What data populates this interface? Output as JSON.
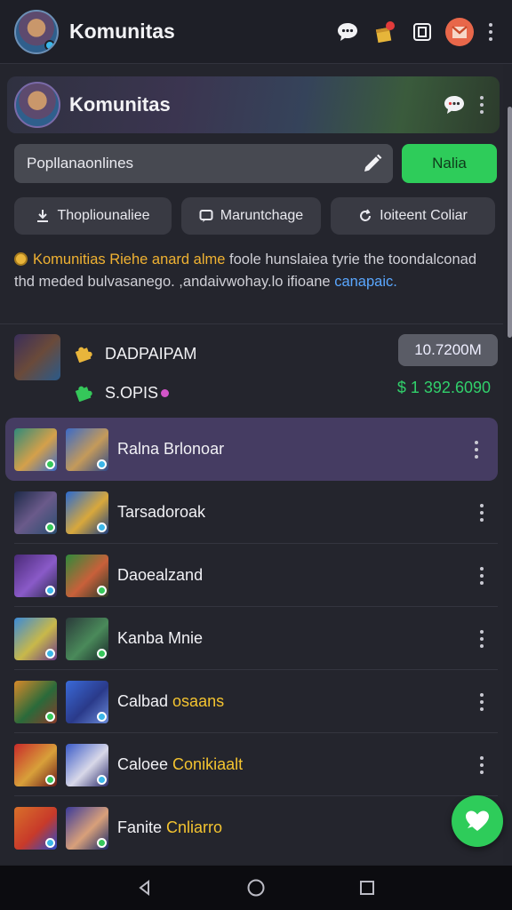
{
  "header": {
    "title": "Komunitas"
  },
  "banner": {
    "title": "Komunitas"
  },
  "search": {
    "value": "Popllanaonlines",
    "button_label": "Nalia"
  },
  "chips": [
    {
      "label": "Thopliounaliee",
      "icon": "download-icon"
    },
    {
      "label": "Maruntchage",
      "icon": "chat-icon"
    },
    {
      "label": "Ioiteent Coliar",
      "icon": "refresh-icon"
    }
  ],
  "notice": {
    "highlight": "Komunitias Riehe anard alme",
    "text1": " foole hunslaiea tyrie the toondalconad thd meded bulvasanego. ,andaivwohay.lo ifioane ",
    "link": "canapaic."
  },
  "stats": {
    "label1": "DADPAIPAM",
    "pill_value": "10.7200M",
    "label2": "S.OPIS",
    "money": "$ 1 392.6090"
  },
  "items": [
    {
      "name": "Ralna Brlonoar",
      "accent": "",
      "active": true
    },
    {
      "name": "Tarsadoroak",
      "accent": "",
      "active": false
    },
    {
      "name": "Daoealzand",
      "accent": "",
      "active": false
    },
    {
      "name": "Kanba Mnie",
      "accent": "",
      "active": false
    },
    {
      "name": "Calbad ",
      "accent": "osaans",
      "active": false
    },
    {
      "name": "Caloee ",
      "accent": "Conikiaalt",
      "active": false
    },
    {
      "name": "Fanite ",
      "accent": "Cnliarro",
      "active": false
    }
  ],
  "colors": {
    "accent_green": "#2ecc5a",
    "active_row": "#453c62",
    "highlight_yellow": "#f0b232",
    "link_blue": "#5aa7ff",
    "money_green": "#31d06b"
  }
}
